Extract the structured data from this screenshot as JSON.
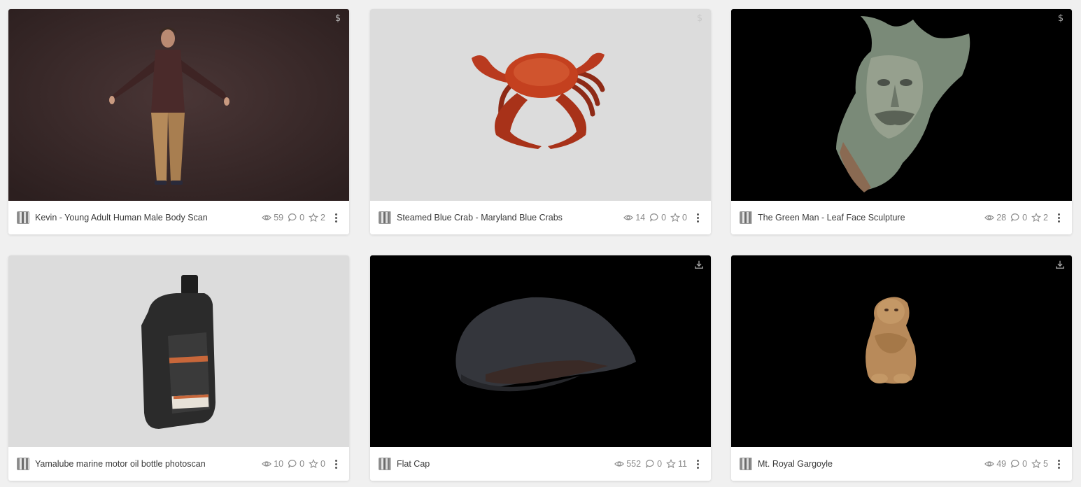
{
  "models": [
    {
      "title": "Kevin - Young Adult Human Male Body Scan",
      "views": "59",
      "comments": "0",
      "likes": "2",
      "badge": "$",
      "background": "#3b2a2a"
    },
    {
      "title": "Steamed Blue Crab - Maryland Blue Crabs",
      "views": "14",
      "comments": "0",
      "likes": "0",
      "badge": "$",
      "background": "#dcdcdc"
    },
    {
      "title": "The Green Man - Leaf Face Sculpture",
      "views": "28",
      "comments": "0",
      "likes": "2",
      "badge": "$",
      "background": "#000000"
    },
    {
      "title": "Yamalube marine motor oil bottle photoscan",
      "views": "10",
      "comments": "0",
      "likes": "0",
      "badge": "",
      "background": "#dcdcdc"
    },
    {
      "title": "Flat Cap",
      "views": "552",
      "comments": "0",
      "likes": "11",
      "badge": "download-icon",
      "background": "#000000"
    },
    {
      "title": "Mt. Royal Gargoyle",
      "views": "49",
      "comments": "0",
      "likes": "5",
      "badge": "download-icon",
      "background": "#000000"
    }
  ],
  "icons": {
    "views": "eye-icon",
    "comments": "comment-icon",
    "likes": "star-icon",
    "menu": "more-vertical-icon",
    "paid": "dollar-icon",
    "download": "download-icon"
  },
  "colors": {
    "page_background": "#f0f0f0",
    "card_background": "#ffffff",
    "text": "#3a3a3a",
    "muted": "#8a8a8a"
  }
}
